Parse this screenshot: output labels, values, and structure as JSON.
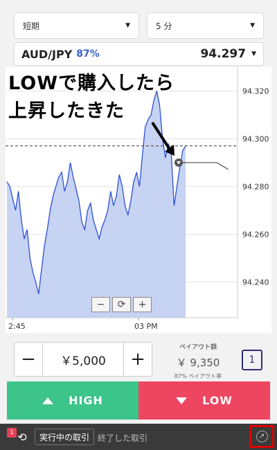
{
  "selects": {
    "term": "短期",
    "interval": "5 分"
  },
  "pair": {
    "name": "AUD/JPY",
    "payout_percent": "87%",
    "price": "94.297"
  },
  "annotation": {
    "line1": "LOWで購入したら",
    "line2": "上昇したきた"
  },
  "chart_data": {
    "type": "line",
    "y_ticks": [
      "94.320",
      "94.300",
      "94.280",
      "94.260",
      "94.240"
    ],
    "ylim": [
      94.225,
      94.33
    ],
    "x_ticks": [
      "2:45",
      "03 PM"
    ],
    "current_price_line": 94.297,
    "entry_marker_price": 94.29,
    "series": [
      {
        "values": [
          94.282,
          94.28,
          94.275,
          94.27,
          94.278,
          94.266,
          94.258,
          94.262,
          94.25,
          94.244,
          94.24,
          94.235,
          94.245,
          94.255,
          94.262,
          94.27,
          94.276,
          94.28,
          94.284,
          94.286,
          94.278,
          94.282,
          94.29,
          94.284,
          94.279,
          94.274,
          94.265,
          94.262,
          94.27,
          94.273,
          94.266,
          94.262,
          94.258,
          94.263,
          94.266,
          94.27,
          94.278,
          94.272,
          94.276,
          94.285,
          94.28,
          94.272,
          94.268,
          94.274,
          94.282,
          94.286,
          94.28,
          94.293,
          94.305,
          94.308,
          94.31,
          94.316,
          94.32,
          94.314,
          94.3,
          94.292,
          94.298,
          94.294,
          94.272,
          94.28,
          94.288,
          94.295,
          94.297
        ]
      }
    ]
  },
  "zoom": {
    "minus": "−",
    "reset": "⟳",
    "plus": "+"
  },
  "amount": {
    "minus": "−",
    "value": "￥5,000",
    "plus": "+"
  },
  "payout": {
    "label": "ペイアウト額",
    "value": "￥ 9,350",
    "rate": "87% ペイアウト率"
  },
  "quantity": "1",
  "actions": {
    "high": "HIGH",
    "low": "LOW"
  },
  "bottom_bar": {
    "count": "1",
    "active_tab": "実行中の取引",
    "closed_tab": "終了した取引"
  },
  "colors": {
    "high": "#3cc48a",
    "low": "#ee4560",
    "chart_line": "#2a4fd6",
    "chart_fill": "#c7d3f2",
    "highlight_border": "#e00000"
  },
  "icons": {
    "caret": "caret-down-icon",
    "sync": "sync-icon",
    "external": "external-link-icon"
  }
}
